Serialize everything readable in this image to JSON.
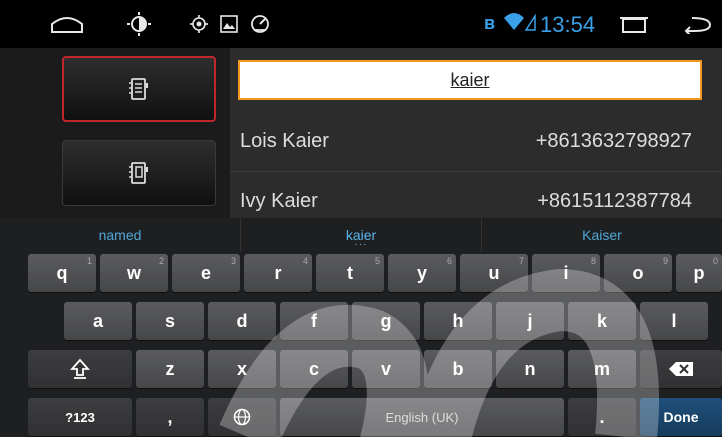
{
  "status_bar": {
    "time": "13:54",
    "icons": [
      "home-icon",
      "brightness-icon",
      "gps-icon",
      "gallery-icon",
      "speed-icon",
      "bluetooth-icon",
      "wifi-icon",
      "window-icon",
      "back-icon"
    ]
  },
  "search": {
    "value": "kaier"
  },
  "contacts": [
    {
      "name": "Lois Kaier",
      "number": "+8613632798927"
    },
    {
      "name": "Ivy Kaier",
      "number": "+8615112387784"
    }
  ],
  "keyboard": {
    "suggestions": [
      "named",
      "kaier",
      "Kaiser"
    ],
    "row1": [
      {
        "label": "q",
        "hint": "1"
      },
      {
        "label": "w",
        "hint": "2"
      },
      {
        "label": "e",
        "hint": "3"
      },
      {
        "label": "r",
        "hint": "4"
      },
      {
        "label": "t",
        "hint": "5"
      },
      {
        "label": "y",
        "hint": "6"
      },
      {
        "label": "u",
        "hint": "7"
      },
      {
        "label": "i",
        "hint": "8"
      },
      {
        "label": "o",
        "hint": "9"
      },
      {
        "label": "p",
        "hint": "0"
      }
    ],
    "row2": [
      "a",
      "s",
      "d",
      "f",
      "g",
      "h",
      "j",
      "k",
      "l"
    ],
    "row3": [
      "z",
      "x",
      "c",
      "v",
      "b",
      "n",
      "m"
    ],
    "symbols_label": "?123",
    "comma_label": ",",
    "space_label": "English (UK)",
    "period_label": ".",
    "done_label": "Done"
  }
}
